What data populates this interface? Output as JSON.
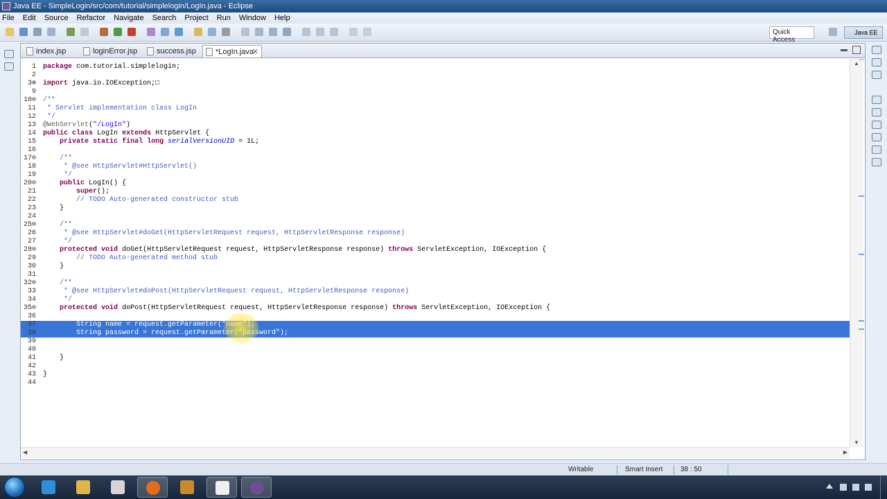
{
  "window": {
    "title": "Java EE - SimpleLogin/src/com/tutorial/simplelogin/LogIn.java - Eclipse"
  },
  "menu": [
    "File",
    "Edit",
    "Source",
    "Refactor",
    "Navigate",
    "Search",
    "Project",
    "Run",
    "Window",
    "Help"
  ],
  "toolbar": {
    "quick_access": "Quick Access",
    "perspective": "Java EE"
  },
  "tabs": [
    {
      "label": "index.jsp"
    },
    {
      "label": "loginError.jsp"
    },
    {
      "label": "success.jsp"
    },
    {
      "label": "*LogIn.java",
      "close": "✕"
    }
  ],
  "code": [
    {
      "n": "1",
      "t": "package com.tutorial.simplelogin;"
    },
    {
      "n": "2",
      "t": ""
    },
    {
      "n": "3⊕",
      "t": "import java.io.IOException;□"
    },
    {
      "n": "9",
      "t": ""
    },
    {
      "n": "10⊖",
      "t": "/**"
    },
    {
      "n": "11",
      "t": " * Servlet implementation class LogIn"
    },
    {
      "n": "12",
      "t": " */"
    },
    {
      "n": "13",
      "t": "@WebServlet(\"/LogIn\")"
    },
    {
      "n": "14",
      "t": "public class LogIn extends HttpServlet {"
    },
    {
      "n": "15",
      "t": "    private static final long serialVersionUID = 1L;"
    },
    {
      "n": "16",
      "t": ""
    },
    {
      "n": "17⊖",
      "t": "    /**"
    },
    {
      "n": "18",
      "t": "     * @see HttpServlet#HttpServlet()"
    },
    {
      "n": "19",
      "t": "     */"
    },
    {
      "n": "20⊖",
      "t": "    public LogIn() {"
    },
    {
      "n": "21",
      "t": "        super();"
    },
    {
      "n": "22",
      "t": "        // TODO Auto-generated constructor stub"
    },
    {
      "n": "23",
      "t": "    }"
    },
    {
      "n": "24",
      "t": ""
    },
    {
      "n": "25⊖",
      "t": "    /**"
    },
    {
      "n": "26",
      "t": "     * @see HttpServlet#doGet(HttpServletRequest request, HttpServletResponse response)"
    },
    {
      "n": "27",
      "t": "     */"
    },
    {
      "n": "28⊖",
      "t": "    protected void doGet(HttpServletRequest request, HttpServletResponse response) throws ServletException, IOException {"
    },
    {
      "n": "29",
      "t": "        // TODO Auto-generated method stub"
    },
    {
      "n": "30",
      "t": "    }"
    },
    {
      "n": "31",
      "t": ""
    },
    {
      "n": "32⊖",
      "t": "    /**"
    },
    {
      "n": "33",
      "t": "     * @see HttpServlet#doPost(HttpServletRequest request, HttpServletResponse response)"
    },
    {
      "n": "34",
      "t": "     */"
    },
    {
      "n": "35⊖",
      "t": "    protected void doPost(HttpServletRequest request, HttpServletResponse response) throws ServletException, IOException {"
    },
    {
      "n": "36",
      "t": ""
    },
    {
      "n": "37",
      "t": "        String name = request.getParameter(\"name\");"
    },
    {
      "n": "38",
      "t": "        String password = request.getParameter(\"password\");"
    },
    {
      "n": "39",
      "t": ""
    },
    {
      "n": "40",
      "t": ""
    },
    {
      "n": "41",
      "t": "    }"
    },
    {
      "n": "42",
      "t": ""
    },
    {
      "n": "43",
      "t": "}"
    },
    {
      "n": "44",
      "t": ""
    }
  ],
  "status": {
    "writable": "Writable",
    "insert_mode": "Smart Insert",
    "position": "38 : 50"
  },
  "colors": {
    "selection": "#3875d7",
    "keyword": "#7f0055",
    "comment": "#3f5fbf",
    "string": "#2a00ff"
  }
}
